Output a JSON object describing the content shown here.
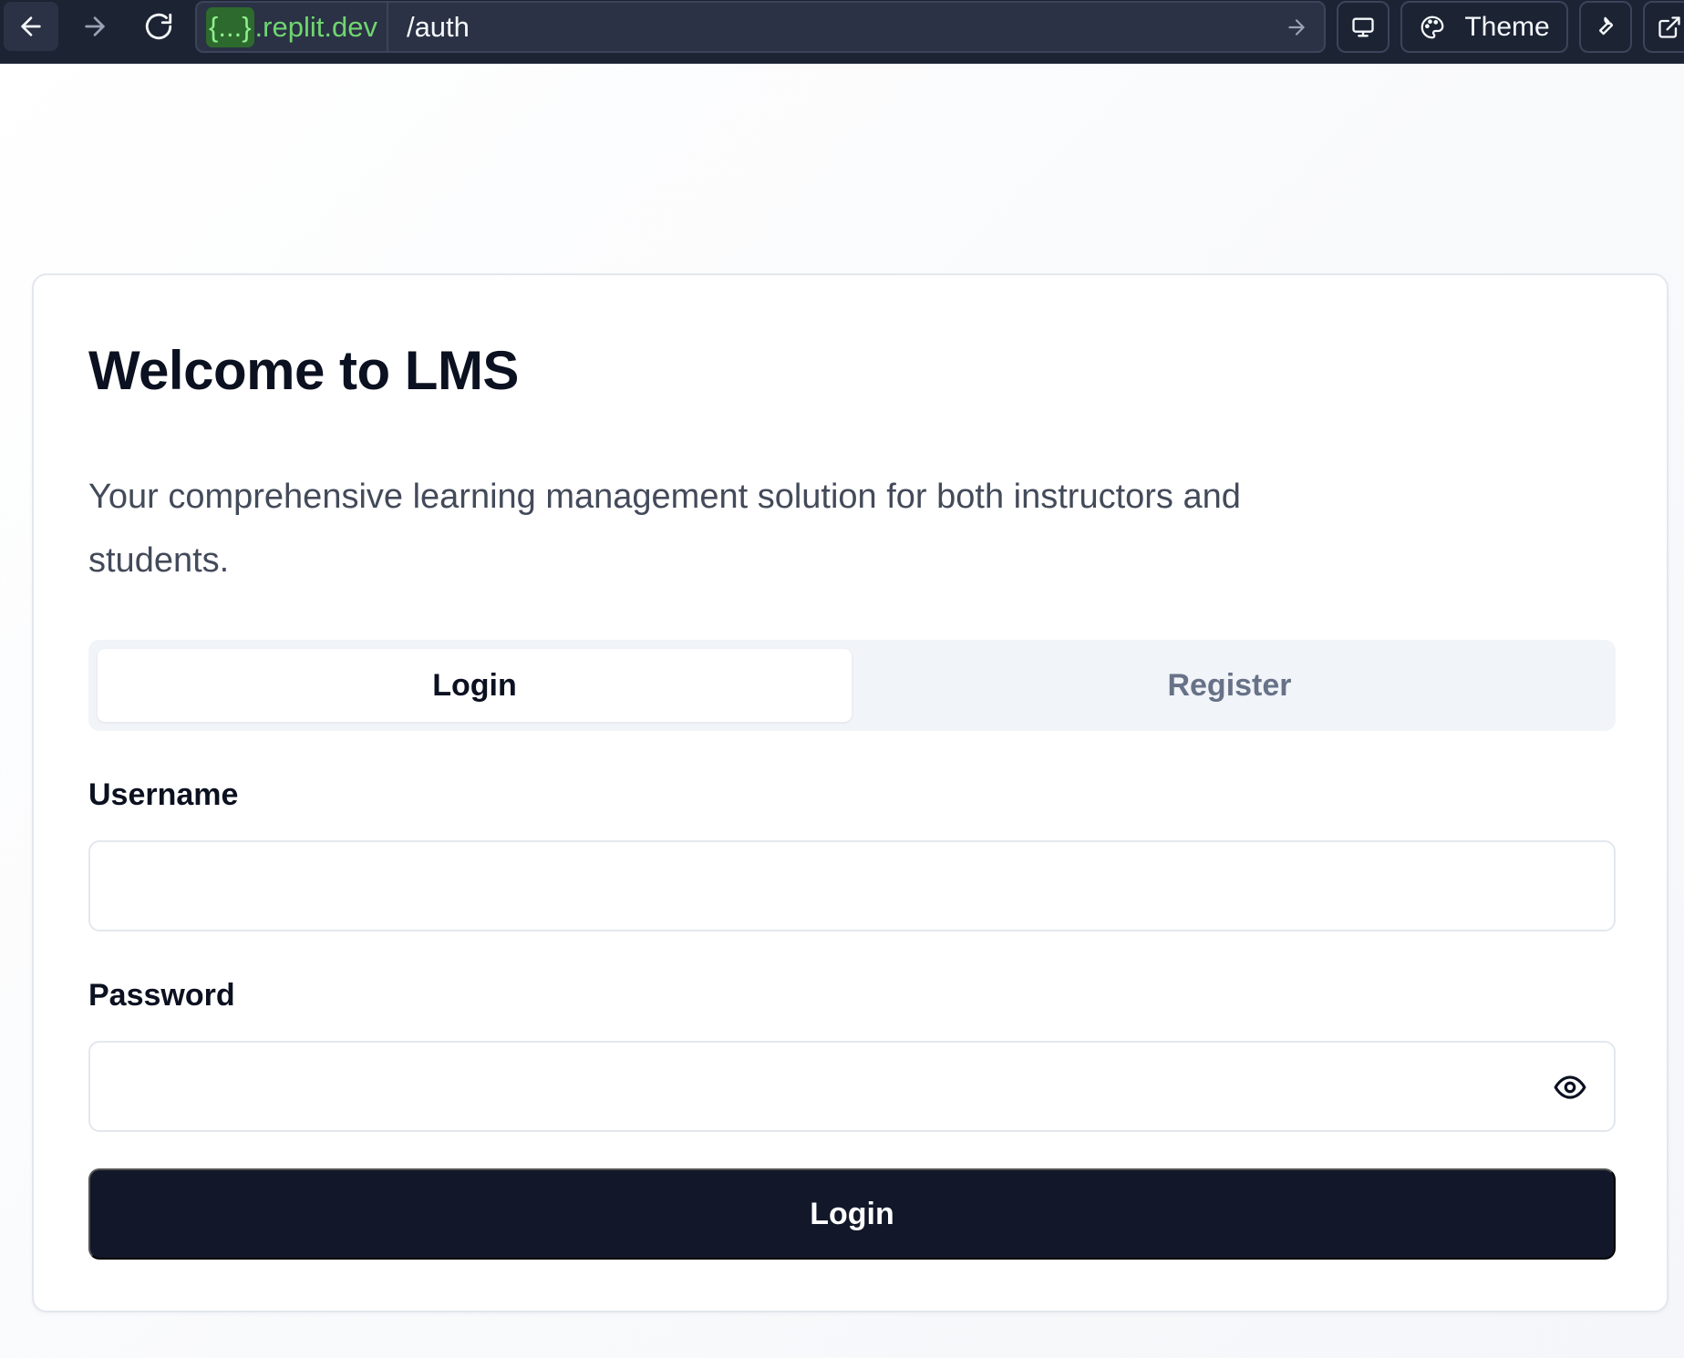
{
  "browser": {
    "url_host_chip": "{...}",
    "url_host": ".replit.dev",
    "url_path": "/auth",
    "theme_label": "Theme",
    "icons": {
      "back": "arrow-left-icon",
      "forward": "arrow-right-icon",
      "reload": "reload-icon",
      "go": "arrow-right-icon",
      "device": "monitor-icon",
      "theme": "palette-icon",
      "tools": "wrench-icon",
      "external": "external-link-icon"
    }
  },
  "auth": {
    "title": "Welcome to LMS",
    "subtitle": "Your comprehensive learning management solution for both instructors and students.",
    "tabs": [
      {
        "label": "Login",
        "active": true
      },
      {
        "label": "Register",
        "active": false
      }
    ],
    "username": {
      "label": "Username",
      "value": "",
      "placeholder": ""
    },
    "password": {
      "label": "Password",
      "value": "",
      "placeholder": "",
      "toggle_icon": "eye-icon"
    },
    "submit_label": "Login"
  },
  "colors": {
    "toolbar_bg": "#1c2333",
    "host_text": "#6fd66f",
    "primary_button": "#121829",
    "tab_track": "#f1f4f8"
  }
}
